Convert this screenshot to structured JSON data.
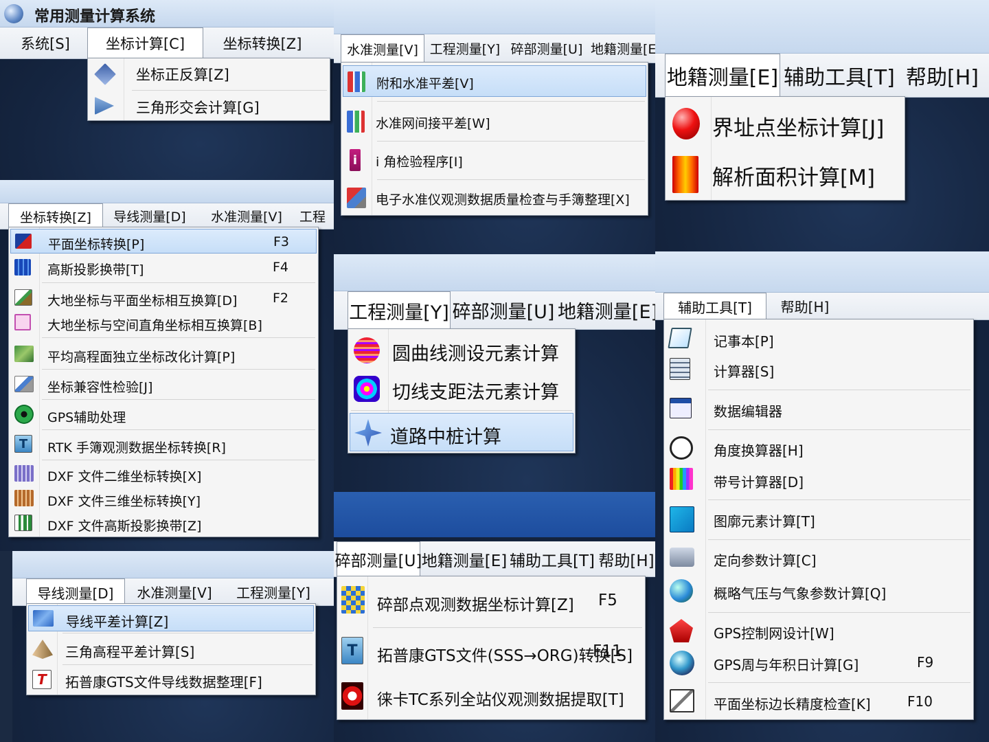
{
  "panel_coord_calc": {
    "window_title": "常用测量计算系统",
    "menu": [
      "系统[S]",
      "坐标计算[C]",
      "坐标转换[Z]"
    ],
    "items": [
      {
        "label": "坐标正反算[Z]",
        "icon": "diamond-icon"
      },
      {
        "label": "三角形交会计算[G]",
        "icon": "triangle-intersect-icon"
      }
    ]
  },
  "panel_leveling": {
    "menu": [
      "水准测量[V]",
      "工程测量[Y]",
      "碎部测量[U]",
      "地籍测量[E]"
    ],
    "items": [
      {
        "label": "附和水准平差[V]",
        "icon": "leveling-adjust-icon"
      },
      {
        "label": "水准网间接平差[W]",
        "icon": "leveling-network-icon"
      },
      {
        "label": "i 角检验程序[I]",
        "icon": "info-icon"
      },
      {
        "label": "电子水准仪观测数据质量检查与手簿整理[X]",
        "icon": "digital-level-icon"
      }
    ]
  },
  "panel_cadastral": {
    "menu": [
      "地籍测量[E]",
      "辅助工具[T]",
      "帮助[H]"
    ],
    "items": [
      {
        "label": "界址点坐标计算[J]",
        "icon": "red-ball-icon"
      },
      {
        "label": "解析面积计算[M]",
        "icon": "area-calc-icon"
      }
    ]
  },
  "panel_coord_transform": {
    "menu": [
      "坐标转换[Z]",
      "导线测量[D]",
      "水准测量[V]",
      "工程"
    ],
    "items": [
      {
        "label": "平面坐标转换[P]",
        "shortcut": "F3",
        "icon": "plane-coord-icon"
      },
      {
        "label": "高斯投影换带[T]",
        "shortcut": "F4",
        "icon": "gauss-grid-icon"
      },
      {
        "label": "大地坐标与平面坐标相互换算[D]",
        "shortcut": "F2",
        "icon": "geodetic-plane-icon"
      },
      {
        "label": "大地坐标与空间直角坐标相互换算[B]",
        "shortcut": "",
        "icon": "geodetic-space-icon"
      },
      {
        "label": "平均高程面独立坐标改化计算[P]",
        "shortcut": "",
        "icon": "map-icon"
      },
      {
        "label": "坐标兼容性检验[J]",
        "shortcut": "",
        "icon": "compatibility-check-icon"
      },
      {
        "label": "GPS辅助处理",
        "shortcut": "",
        "icon": "gps-eye-icon"
      },
      {
        "label": "RTK 手簿观测数据坐标转换[R]",
        "shortcut": "",
        "icon": "rtk-t-icon"
      },
      {
        "label": "DXF 文件二维坐标转换[X]",
        "shortcut": "",
        "icon": "dxf-2d-icon"
      },
      {
        "label": "DXF 文件三维坐标转换[Y]",
        "shortcut": "",
        "icon": "dxf-3d-icon"
      },
      {
        "label": "DXF 文件高斯投影换带[Z]",
        "shortcut": "",
        "icon": "dxf-gauss-icon"
      }
    ]
  },
  "panel_engineering": {
    "menu": [
      "工程测量[Y]",
      "碎部测量[U]",
      "地籍测量[E]"
    ],
    "items": [
      {
        "label": "圆曲线测设元素计算",
        "icon": "circle-curve-icon"
      },
      {
        "label": "切线支距法元素计算",
        "icon": "spiral-icon"
      },
      {
        "label": "道路中桩计算",
        "icon": "star-icon"
      }
    ]
  },
  "panel_tools": {
    "menu": [
      "辅助工具[T]",
      "帮助[H]"
    ],
    "items": [
      {
        "label": "记事本[P]",
        "shortcut": "",
        "icon": "notepad-icon"
      },
      {
        "label": "计算器[S]",
        "shortcut": "",
        "icon": "calculator-icon"
      },
      {
        "label": "数据编辑器",
        "shortcut": "",
        "icon": "data-editor-icon"
      },
      {
        "label": "角度换算器[H]",
        "shortcut": "",
        "icon": "clock-icon"
      },
      {
        "label": "带号计算器[D]",
        "shortcut": "",
        "icon": "zone-number-icon"
      },
      {
        "label": "图廓元素计算[T]",
        "shortcut": "",
        "icon": "map-frame-icon"
      },
      {
        "label": "定向参数计算[C]",
        "shortcut": "",
        "icon": "orientation-icon"
      },
      {
        "label": "概略气压与气象参数计算[Q]",
        "shortcut": "",
        "icon": "globe-icon"
      },
      {
        "label": "GPS控制网设计[W]",
        "shortcut": "",
        "icon": "pentagon-icon"
      },
      {
        "label": "GPS周与年积日计算[G]",
        "shortcut": "F9",
        "icon": "earth-icon"
      },
      {
        "label": "平面坐标边长精度检查[K]",
        "shortcut": "F10",
        "icon": "precision-check-icon"
      }
    ]
  },
  "panel_traverse": {
    "menu": [
      "导线测量[D]",
      "水准测量[V]",
      "工程测量[Y]"
    ],
    "items": [
      {
        "label": "导线平差计算[Z]",
        "icon": "traverse-icon"
      },
      {
        "label": "三角高程平差计算[S]",
        "icon": "pyramid-icon"
      },
      {
        "label": "拓普康GTS文件导线数据整理[F]",
        "icon": "topcon-t-icon"
      }
    ]
  },
  "panel_detail": {
    "menu": [
      "碎部测量[U]",
      "地籍测量[E]",
      "辅助工具[T]",
      "帮助[H]"
    ],
    "items": [
      {
        "label": "碎部点观测数据坐标计算[Z]",
        "shortcut": "F5",
        "icon": "detail-points-icon"
      },
      {
        "label": "拓普康GTS文件(SSS→ORG)转换[S]",
        "shortcut": "F11",
        "icon": "topcon-t-icon"
      },
      {
        "label": "徕卡TC系列全站仪观测数据提取[T]",
        "shortcut": "",
        "icon": "leica-c-icon"
      }
    ]
  }
}
